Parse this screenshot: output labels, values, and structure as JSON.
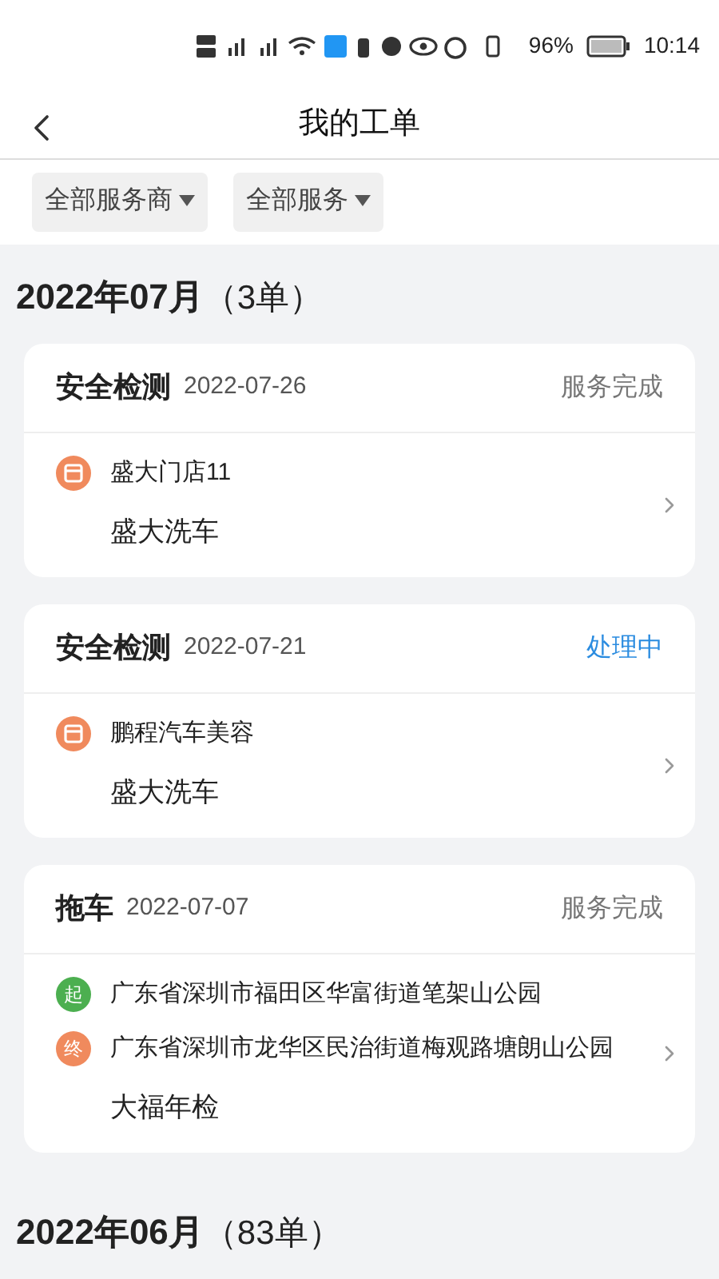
{
  "status_bar": {
    "battery": "96%",
    "time": "10:14"
  },
  "header": {
    "title": "我的工单"
  },
  "filters": [
    {
      "label": "全部服务商"
    },
    {
      "label": "全部服务"
    }
  ],
  "groups": [
    {
      "title": "2022年07月",
      "count": "（3单）",
      "orders": [
        {
          "service": "安全检测",
          "date": "2022-07-26",
          "status": {
            "kind": "done",
            "text": "服务完成"
          },
          "stops": [
            {
              "kind": "store",
              "text": "盛大门店11"
            }
          ],
          "provider": "盛大洗车"
        },
        {
          "service": "安全检测",
          "date": "2022-07-21",
          "status": {
            "kind": "processing",
            "text": "处理中"
          },
          "stops": [
            {
              "kind": "store",
              "text": "鹏程汽车美容"
            }
          ],
          "provider": "盛大洗车"
        },
        {
          "service": "拖车",
          "date": "2022-07-07",
          "status": {
            "kind": "done",
            "text": "服务完成"
          },
          "stops": [
            {
              "kind": "start",
              "badge": "起",
              "text": "广东省深圳市福田区华富街道笔架山公园"
            },
            {
              "kind": "end",
              "badge": "终",
              "text": "广东省深圳市龙华区民治街道梅观路塘朗山公园"
            }
          ],
          "provider": "大福年检"
        }
      ]
    },
    {
      "title": "2022年06月",
      "count": "（83单）"
    }
  ]
}
